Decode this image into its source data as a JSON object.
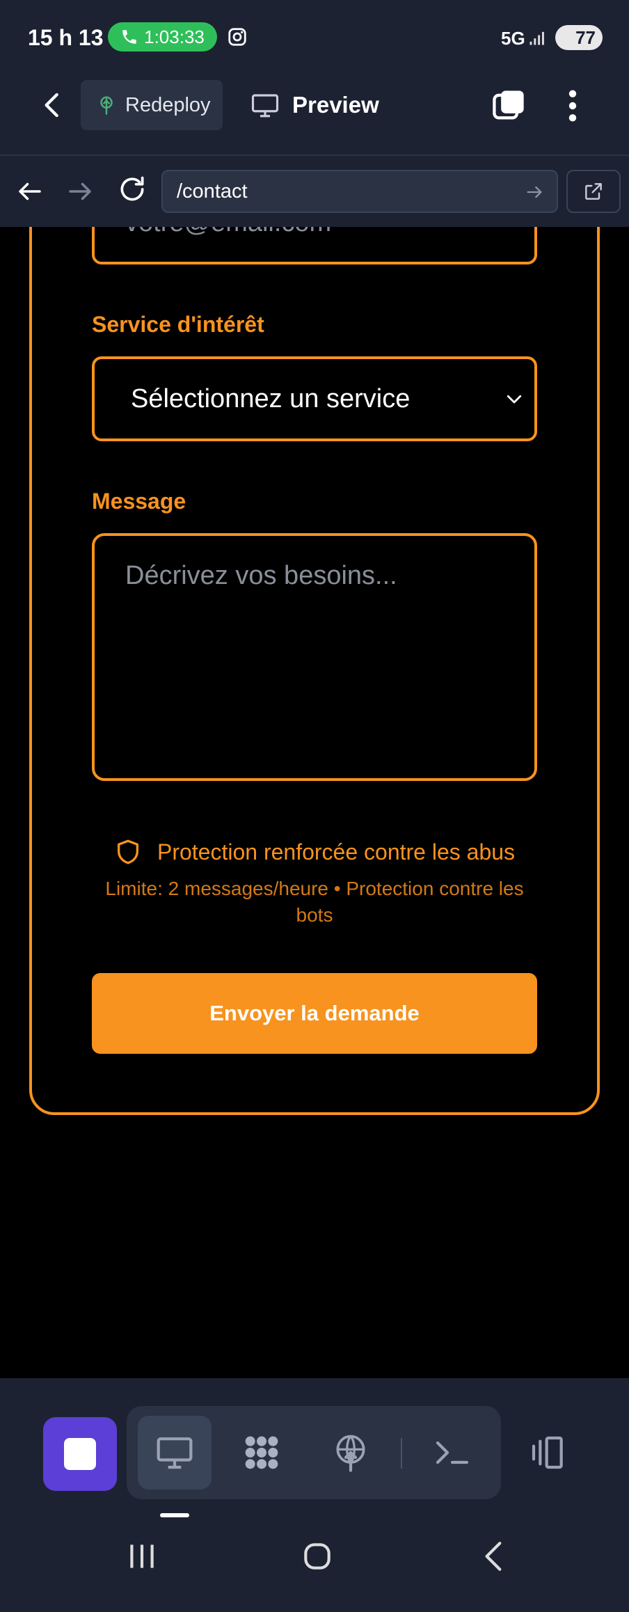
{
  "status_bar": {
    "time": "15 h 13",
    "call_timer": "1:03:33",
    "network": "5G",
    "battery": "77",
    "icons": [
      "phone-icon",
      "instagram-icon",
      "signal-icon",
      "battery-icon"
    ]
  },
  "app_bar": {
    "redeploy_label": "Redeploy",
    "preview_label": "Preview",
    "icons": [
      "back-arrow-icon",
      "deploy-tree-icon",
      "monitor-icon",
      "tabs-icon",
      "more-vertical-icon"
    ]
  },
  "url_bar": {
    "url": "/contact",
    "icons": [
      "back-icon",
      "forward-icon",
      "reload-icon",
      "go-arrow-icon",
      "external-link-icon"
    ]
  },
  "form": {
    "email_value": "votre@email.com",
    "service_label": "Service d'intérêt",
    "service_selected": "Sélectionnez un service",
    "message_label": "Message",
    "message_placeholder": "Décrivez vos besoins...",
    "protection_title": "Protection renforcée contre les abus",
    "protection_detail": "Limite: 2 messages/heure • Protection contre les bots",
    "submit_label": "Envoyer la demande"
  },
  "colors": {
    "accent": "#f7931e",
    "chrome_bg": "#1c2232",
    "stop_button": "#5b3fd6"
  },
  "dock": {
    "icons": [
      "stop-icon",
      "monitor-icon",
      "grid-dots-icon",
      "deploy-globe-icon",
      "terminal-icon",
      "split-view-icon"
    ]
  }
}
